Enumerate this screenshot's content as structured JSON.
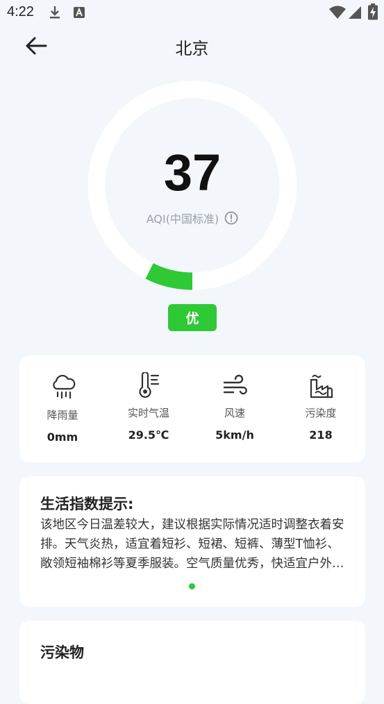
{
  "status_bar": {
    "time": "4:22",
    "icons": [
      "download-icon",
      "a-badge-icon",
      "wifi-icon",
      "signal-icon",
      "battery-charging-icon"
    ]
  },
  "header": {
    "title": "北京",
    "back_icon": "arrow-left-icon"
  },
  "aqi": {
    "value": "37",
    "label": "AQI(中国标准)",
    "level": "优",
    "progress_fraction": 0.074,
    "colors": {
      "track": "#ffffff",
      "progress": "#2ec935",
      "badge": "#2ec935"
    }
  },
  "stats": [
    {
      "icon": "rain-cloud-icon",
      "label": "降雨量",
      "value": "0mm"
    },
    {
      "icon": "thermometer-icon",
      "label": "实时气温",
      "value": "29.5℃"
    },
    {
      "icon": "wind-icon",
      "label": "风速",
      "value": "5km/h"
    },
    {
      "icon": "factory-pollution-icon",
      "label": "污染度",
      "value": "218"
    }
  ],
  "tips": {
    "title": "生活指数提示:",
    "text": "该地区今日温差较大，建议根据实际情况适时调整衣着安排。天气炎热，适宜着短衫、短裙、短裤、薄型T恤衫、敞领短袖棉衫等夏季服装。空气质量优秀，快适宜户外活动，请尽情享受清新的空气。"
  },
  "pollutants": {
    "title": "污染物"
  }
}
